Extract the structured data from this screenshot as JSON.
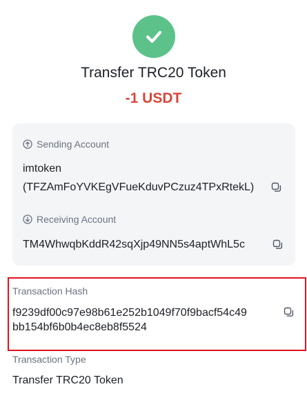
{
  "header": {
    "status_icon": "checkmark-icon",
    "title": "Transfer TRC20 Token",
    "amount": "-1 USDT",
    "accent_color": "#5cc28a",
    "amount_color": "#d9473a"
  },
  "sending": {
    "label": "Sending Account",
    "icon": "arrow-up-circle-icon",
    "name": "imtoken",
    "address": "(TFZAmFoYVKEgVFueKduvPCzuz4TPxRtekL)"
  },
  "receiving": {
    "label": "Receiving Account",
    "icon": "arrow-down-circle-icon",
    "address": "TM4WhwqbKddR42sqXjp49NN5s4aptWhL5c"
  },
  "transaction": {
    "hash_label": "Transaction Hash",
    "hash_line1": "f9239df00c97e98b61e252b1049f70f9bacf54c49",
    "hash_line2": "bb154bf6b0b4ec8eb8f5524",
    "type_label": "Transaction Type",
    "type_value": "Transfer TRC20 Token",
    "highlight_color": "#e0111e"
  }
}
